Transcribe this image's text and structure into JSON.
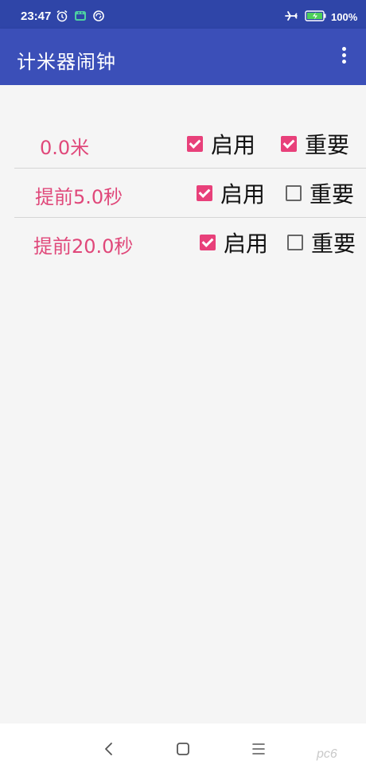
{
  "status_bar": {
    "time": "23:47",
    "battery": "100%",
    "icons": [
      "alarm-icon",
      "android-icon",
      "sync-icon",
      "airplane-icon",
      "battery-charging-icon"
    ]
  },
  "app_bar": {
    "title": "计米器闹钟",
    "menu_icon": "more-vert-icon"
  },
  "alarms": [
    {
      "label": "0.0米",
      "enable_label": "启用",
      "enable_checked": true,
      "important_label": "重要",
      "important_checked": true
    },
    {
      "label": "提前5.0秒",
      "enable_label": "启用",
      "enable_checked": true,
      "important_label": "重要",
      "important_checked": false
    },
    {
      "label": "提前20.0秒",
      "enable_label": "启用",
      "enable_checked": true,
      "important_label": "重要",
      "important_checked": false
    }
  ],
  "nav_bar": {
    "icons": [
      "back-icon",
      "home-icon",
      "menu-icon"
    ]
  },
  "watermark": "pc6",
  "colors": {
    "status_bar": "#2f45a8",
    "app_bar": "#3b4fb8",
    "accent": "#e8407a",
    "label": "#e0487a",
    "background": "#f5f5f5"
  }
}
